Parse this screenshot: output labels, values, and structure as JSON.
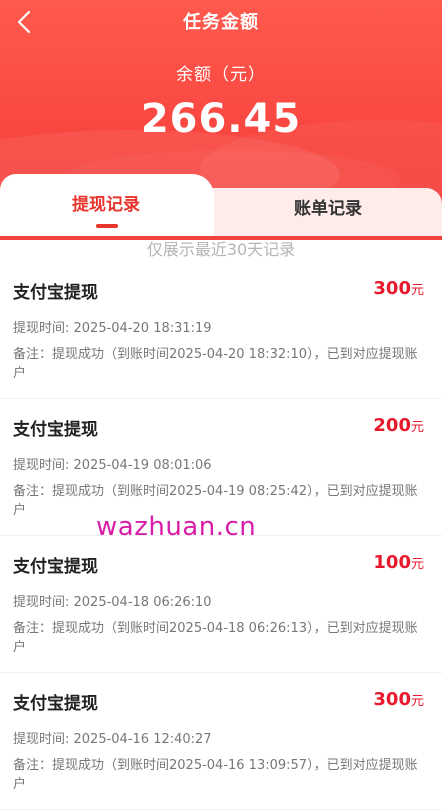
{
  "header": {
    "title": "任务金额",
    "balance_label": "余额（元）",
    "balance_value": "266.45"
  },
  "tabs": [
    {
      "label": "提现记录",
      "active": true
    },
    {
      "label": "账单记录",
      "active": false
    }
  ],
  "notice": "仅展示最近30天记录",
  "records": [
    {
      "title": "支付宝提现",
      "amount": "300",
      "unit": "元",
      "time": "提现时间: 2025-04-20 18:31:19",
      "note": "备注：提现成功（到账时间2025-04-20 18:32:10），已到对应提现账户"
    },
    {
      "title": "支付宝提现",
      "amount": "200",
      "unit": "元",
      "time": "提现时间: 2025-04-19 08:01:06",
      "note": "备注：提现成功（到账时间2025-04-19 08:25:42），已到对应提现账户"
    },
    {
      "title": "支付宝提现",
      "amount": "100",
      "unit": "元",
      "time": "提现时间: 2025-04-18 06:26:10",
      "note": "备注：提现成功（到账时间2025-04-18 06:26:13），已到对应提现账户"
    },
    {
      "title": "支付宝提现",
      "amount": "300",
      "unit": "元",
      "time": "提现时间: 2025-04-16 12:40:27",
      "note": "备注：提现成功（到账时间2025-04-16 13:09:57），已到对应提现账户"
    }
  ],
  "watermark": "wazhuan.cn",
  "colors": {
    "header": "#f8453f",
    "accent": "#e8342d",
    "amount": "#e8192c",
    "watermark": "#d81ea8"
  }
}
